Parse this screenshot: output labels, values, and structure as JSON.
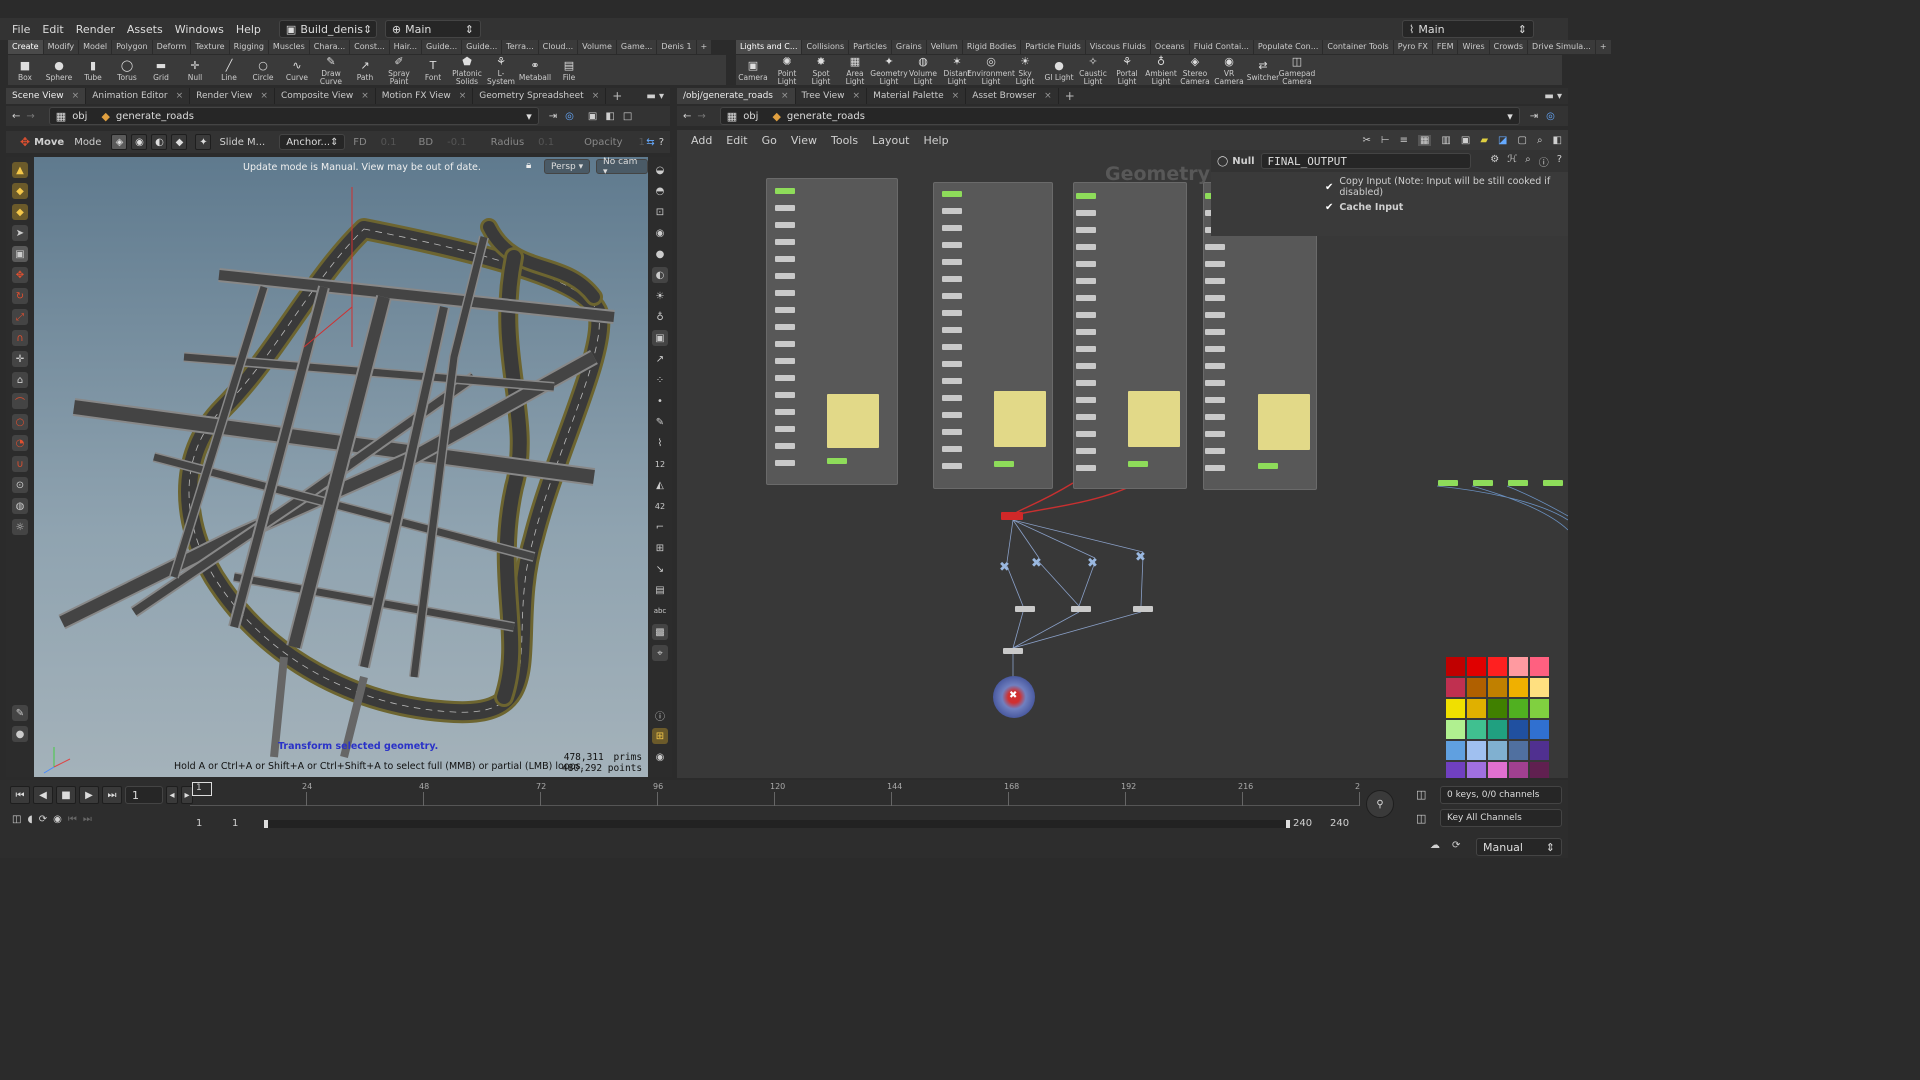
{
  "menu": [
    "File",
    "Edit",
    "Render",
    "Assets",
    "Windows",
    "Help"
  ],
  "desktop": "Build_denis",
  "context": "Main",
  "right_context": "Main",
  "shelf_tabs_left": [
    "Create",
    "Modify",
    "Model",
    "Polygon",
    "Deform",
    "Texture",
    "Rigging",
    "Muscles",
    "Chara...",
    "Const...",
    "Hair...",
    "Guide...",
    "Guide...",
    "Terra...",
    "Cloud...",
    "Volume",
    "Game...",
    "Denis 1"
  ],
  "shelf_tabs_right": [
    "Lights and C...",
    "Collisions",
    "Particles",
    "Grains",
    "Vellum",
    "Rigid Bodies",
    "Particle Fluids",
    "Viscous Fluids",
    "Oceans",
    "Fluid Contai...",
    "Populate Con...",
    "Container Tools",
    "Pyro FX",
    "FEM",
    "Wires",
    "Crowds",
    "Drive Simula..."
  ],
  "tools_left": [
    {
      "label": "Box",
      "icon": "cube-icon"
    },
    {
      "label": "Sphere",
      "icon": "sphere-icon"
    },
    {
      "label": "Tube",
      "icon": "tube-icon"
    },
    {
      "label": "Torus",
      "icon": "torus-icon"
    },
    {
      "label": "Grid",
      "icon": "grid-icon"
    },
    {
      "label": "Null",
      "icon": "null-icon"
    },
    {
      "label": "Line",
      "icon": "line-icon"
    },
    {
      "label": "Circle",
      "icon": "circle-icon"
    },
    {
      "label": "Curve",
      "icon": "curve-icon"
    },
    {
      "label": "Draw Curve",
      "icon": "draw-curve-icon"
    },
    {
      "label": "Path",
      "icon": "path-icon"
    },
    {
      "label": "Spray Paint",
      "icon": "spray-paint-icon"
    },
    {
      "label": "Font",
      "icon": "font-icon"
    },
    {
      "label": "Platonic Solids",
      "icon": "platonic-icon"
    },
    {
      "label": "L-System",
      "icon": "lsystem-icon"
    },
    {
      "label": "Metaball",
      "icon": "metaball-icon"
    },
    {
      "label": "File",
      "icon": "file-icon"
    }
  ],
  "tools_right": [
    {
      "label": "Camera",
      "icon": "camera-icon"
    },
    {
      "label": "Point Light",
      "icon": "point-light-icon"
    },
    {
      "label": "Spot Light",
      "icon": "spot-light-icon"
    },
    {
      "label": "Area Light",
      "icon": "area-light-icon"
    },
    {
      "label": "Geometry Light",
      "icon": "geometry-light-icon"
    },
    {
      "label": "Volume Light",
      "icon": "volume-light-icon"
    },
    {
      "label": "Distant Light",
      "icon": "distant-light-icon"
    },
    {
      "label": "Environment Light",
      "icon": "environment-light-icon"
    },
    {
      "label": "Sky Light",
      "icon": "sky-light-icon"
    },
    {
      "label": "GI Light",
      "icon": "gi-light-icon"
    },
    {
      "label": "Caustic Light",
      "icon": "caustic-light-icon"
    },
    {
      "label": "Portal Light",
      "icon": "portal-light-icon"
    },
    {
      "label": "Ambient Light",
      "icon": "ambient-light-icon"
    },
    {
      "label": "Stereo Camera",
      "icon": "stereo-camera-icon"
    },
    {
      "label": "VR Camera",
      "icon": "vr-camera-icon"
    },
    {
      "label": "Switcher",
      "icon": "switcher-icon"
    },
    {
      "label": "Gamepad Camera",
      "icon": "gamepad-camera-icon"
    }
  ],
  "left_panel_tabs": [
    "Scene View",
    "Animation Editor",
    "Render View",
    "Composite View",
    "Motion FX View",
    "Geometry Spreadsheet"
  ],
  "right_panel_tabs": [
    "/obj/generate_roads",
    "Tree View",
    "Material Palette",
    "Asset Browser"
  ],
  "path": {
    "root": "obj",
    "node": "generate_roads"
  },
  "handle": {
    "tool": "Move",
    "mode": "Mode",
    "slide": "Slide M...",
    "anchor": "Anchor...",
    "fd_label": "FD",
    "fd_val": "0.1",
    "bd_label": "BD",
    "bd_val": "-0.1",
    "radius_label": "Radius",
    "radius_val": "0.1",
    "opacity_label": "Opacity",
    "opacity_val": "1"
  },
  "viewport": {
    "update_msg": "Update mode is Manual. View may be out of date.",
    "persp": "Persp ▾",
    "cam": "No cam ▾",
    "hint1": "Transform selected geometry.",
    "hint2": "Hold A or Ctrl+A or Shift+A or Ctrl+Shift+A to select full (MMB) or partial (LMB) loops.",
    "prims_num": "478,311",
    "prims_lbl": "prims",
    "points_num": "480,292",
    "points_lbl": "points"
  },
  "network": {
    "menu": [
      "Add",
      "Edit",
      "Go",
      "View",
      "Tools",
      "Layout",
      "Help"
    ],
    "watermark": "Geometry",
    "node_type": "Null",
    "node_name": "FINAL_OUTPUT",
    "param1": "Copy Input (Note: Input will be still cooked if disabled)",
    "param2": "Cache Input"
  },
  "timeline": {
    "frame": "1",
    "ticks": [
      "24",
      "48",
      "72",
      "96",
      "120",
      "144",
      "168",
      "192",
      "216",
      "2"
    ],
    "start": "1",
    "start2": "1",
    "end": "240",
    "end2": "240",
    "keys": "0 keys, 0/0 channels",
    "key_all": "Key All Channels"
  },
  "status": {
    "mode": "Manual"
  },
  "swatches": [
    "#c00000",
    "#e00000",
    "#ff2020",
    "#ff9aa0",
    "#ff6080",
    "#c03050",
    "#b06000",
    "#c08000",
    "#f0b000",
    "#ffe080",
    "#f0e000",
    "#e0b000",
    "#408000",
    "#50b020",
    "#80d040",
    "#b0f090",
    "#40c090",
    "#20a080",
    "#2050a0",
    "#3070d0",
    "#60a0e0",
    "#a0c0f0",
    "#80b0d0",
    "#5070a0",
    "#503090",
    "#7040c0",
    "#a070e0",
    "#e070d0",
    "#a04090",
    "#602050",
    "#000000",
    "#404040",
    "#707070",
    "#a0a0a0",
    "#d0d0d0",
    "#ffffff"
  ]
}
